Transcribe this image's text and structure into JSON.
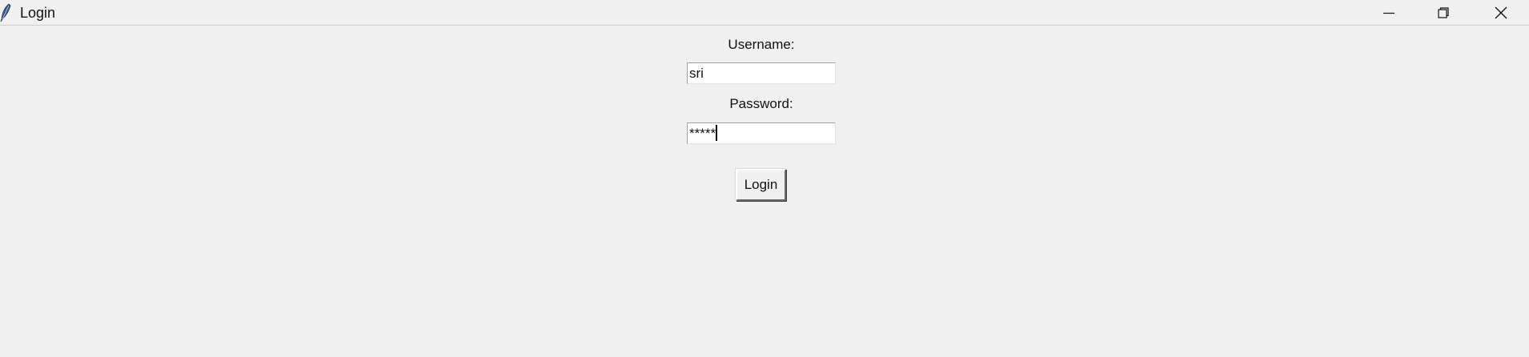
{
  "window": {
    "title": "Login",
    "app_icon": "feather-icon",
    "controls": [
      "minimize-icon",
      "restore-icon",
      "close-icon"
    ]
  },
  "form": {
    "username_label": "Username:",
    "username_value": "sri",
    "password_label": "Password:",
    "password_value": "*****",
    "login_button": "Login"
  }
}
